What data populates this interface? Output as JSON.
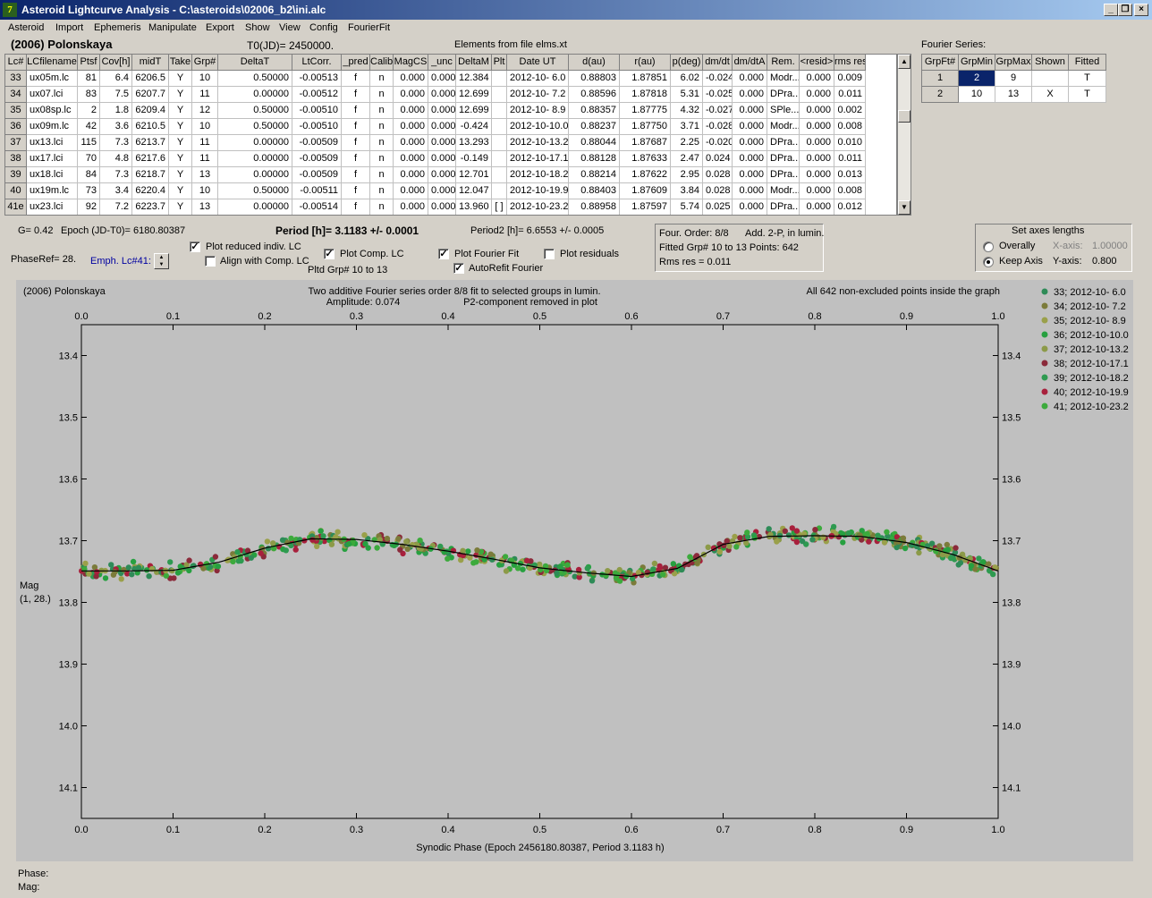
{
  "window": {
    "title": "Asteroid Lightcurve Analysis - C:\\asteroids\\02006_b2\\ini.alc",
    "minimize_label": "_",
    "restore_label": "❐",
    "close_label": "×"
  },
  "menu": [
    "Asteroid",
    "Import",
    "Ephemeris",
    "Manipulate",
    "Export",
    "Show",
    "View",
    "Config",
    "FourierFit"
  ],
  "header": {
    "asteroid_name": "(2006) Polonskaya",
    "t0": "T0(JD)= 2450000.",
    "elements": "Elements from file elms.xt"
  },
  "table": {
    "columns": [
      "Lc#",
      "LCfilename",
      "Ptsf",
      "Cov[h]",
      "midT",
      "Take",
      "Grp#",
      "DeltaT",
      "LtCorr.",
      "_pred",
      "Calib",
      "MagCS",
      "_unc",
      "DeltaM",
      "Plt",
      "Date UT",
      "d(au)",
      "r(au)",
      "p(deg)",
      "dm/dt",
      "dm/dtA",
      "Rem.",
      "<resid>",
      "rms res"
    ],
    "rows": [
      [
        "33",
        "ux05m.lc",
        "81",
        "6.4",
        "6206.5",
        "Y",
        "10",
        "0.50000",
        "-0.00513",
        "f",
        "n",
        "0.000",
        "0.000",
        "12.384",
        "",
        "2012-10- 6.0",
        "0.88803",
        "1.87851",
        "6.02",
        "-0.024",
        "0.000",
        "Modr...",
        "0.000",
        "0.009"
      ],
      [
        "34",
        "ux07.lci",
        "83",
        "7.5",
        "6207.7",
        "Y",
        "11",
        "0.00000",
        "-0.00512",
        "f",
        "n",
        "0.000",
        "0.000",
        "12.699",
        "",
        "2012-10- 7.2",
        "0.88596",
        "1.87818",
        "5.31",
        "-0.025",
        "0.000",
        "DPra...",
        "0.000",
        "0.011"
      ],
      [
        "35",
        "ux08sp.lc",
        "2",
        "1.8",
        "6209.4",
        "Y",
        "12",
        "0.50000",
        "-0.00510",
        "f",
        "n",
        "0.000",
        "0.000",
        "12.699",
        "",
        "2012-10- 8.9",
        "0.88357",
        "1.87775",
        "4.32",
        "-0.027",
        "0.000",
        "SPle...",
        "0.000",
        "0.002"
      ],
      [
        "36",
        "ux09m.lc",
        "42",
        "3.6",
        "6210.5",
        "Y",
        "10",
        "0.50000",
        "-0.00510",
        "f",
        "n",
        "0.000",
        "0.000",
        "-0.424",
        "",
        "2012-10-10.0",
        "0.88237",
        "1.87750",
        "3.71",
        "-0.028",
        "0.000",
        "Modr...",
        "0.000",
        "0.008"
      ],
      [
        "37",
        "ux13.lci",
        "115",
        "7.3",
        "6213.7",
        "Y",
        "11",
        "0.00000",
        "-0.00509",
        "f",
        "n",
        "0.000",
        "0.000",
        "13.293",
        "",
        "2012-10-13.2",
        "0.88044",
        "1.87687",
        "2.25",
        "-0.020",
        "0.000",
        "DPra...",
        "0.000",
        "0.010"
      ],
      [
        "38",
        "ux17.lci",
        "70",
        "4.8",
        "6217.6",
        "Y",
        "11",
        "0.00000",
        "-0.00509",
        "f",
        "n",
        "0.000",
        "0.000",
        "-0.149",
        "",
        "2012-10-17.1",
        "0.88128",
        "1.87633",
        "2.47",
        "0.024",
        "0.000",
        "DPra...",
        "0.000",
        "0.011"
      ],
      [
        "39",
        "ux18.lci",
        "84",
        "7.3",
        "6218.7",
        "Y",
        "13",
        "0.00000",
        "-0.00509",
        "f",
        "n",
        "0.000",
        "0.000",
        "12.701",
        "",
        "2012-10-18.2",
        "0.88214",
        "1.87622",
        "2.95",
        "0.028",
        "0.000",
        "DPra...",
        "0.000",
        "0.013"
      ],
      [
        "40",
        "ux19m.lc",
        "73",
        "3.4",
        "6220.4",
        "Y",
        "10",
        "0.50000",
        "-0.00511",
        "f",
        "n",
        "0.000",
        "0.000",
        "12.047",
        "",
        "2012-10-19.9",
        "0.88403",
        "1.87609",
        "3.84",
        "0.028",
        "0.000",
        "Modr...",
        "0.000",
        "0.008"
      ],
      [
        "41e",
        "ux23.lci",
        "92",
        "7.2",
        "6223.7",
        "Y",
        "13",
        "0.00000",
        "-0.00514",
        "f",
        "n",
        "0.000",
        "0.000",
        "13.960",
        "[ ]",
        "2012-10-23.2",
        "0.88958",
        "1.87597",
        "5.74",
        "0.025",
        "0.000",
        "DPra...",
        "0.000",
        "0.012"
      ]
    ]
  },
  "fourier_series": {
    "title": "Fourier Series:",
    "columns": [
      "GrpFt#",
      "GrpMin",
      "GrpMax",
      "Shown",
      "Fitted"
    ],
    "rows": [
      [
        "1",
        "2",
        "9",
        "",
        "T"
      ],
      [
        "2",
        "10",
        "13",
        "X",
        "T"
      ]
    ]
  },
  "controls": {
    "g": "G= 0.42",
    "epoch": "Epoch (JD-T0)= 6180.80387",
    "period": "Period [h]= 3.1183 +/- 0.0001",
    "period2": "Period2 [h]= 6.6553 +/- 0.0005",
    "phaseref": "PhaseRef= 28.",
    "emph": "Emph. Lc#41:",
    "plot_reduced": "Plot reduced indiv. LC",
    "align_comp": "Align with Comp. LC",
    "plot_comp": "Plot Comp. LC",
    "pltd_grp": "Pltd Grp#  10 to   13",
    "plot_fourier": "Plot Fourier Fit",
    "autorefit": "AutoRefit Fourier",
    "plot_residuals": "Plot residuals",
    "check_mark": "✓"
  },
  "fit_info": {
    "order": "Four. Order:  8/8",
    "add": "Add. 2-P, in lumin.",
    "fitted": "Fitted Grp# 10 to 13 Points: 642",
    "rms": "Rms res     = 0.011"
  },
  "axes_box": {
    "title": "Set axes lengths",
    "overally": "Overally",
    "keep": "Keep Axis",
    "xaxis_label": "X-axis:",
    "xaxis_value": "1.00000",
    "yaxis_label": "Y-axis:",
    "yaxis_value": "0.800"
  },
  "chart_data": {
    "type": "scatter",
    "title": "Two additive Fourier series order 8/8 fit to selected groups in lumin.",
    "subtitle_left": "(2006) Polonskaya",
    "amplitude": "Amplitude: 0.074",
    "p2_note": "P2-component removed in plot",
    "points_note": "All 642 non-excluded points inside the graph",
    "xlabel": "Synodic Phase (Epoch 2456180.80387, Period 3.1183 h)",
    "ylabel_line1": "Mag",
    "ylabel_line2": "(1, 28.)",
    "xlim": [
      0.0,
      1.0
    ],
    "ylim": [
      13.35,
      14.15
    ],
    "y_inverted": true,
    "x_ticks": [
      "0.0",
      "0.1",
      "0.2",
      "0.3",
      "0.4",
      "0.5",
      "0.6",
      "0.7",
      "0.8",
      "0.9",
      "1.0"
    ],
    "y_ticks": [
      "13.4",
      "13.5",
      "13.6",
      "13.7",
      "13.8",
      "13.9",
      "14.0",
      "14.1"
    ],
    "fit_curve": [
      [
        0.0,
        13.749
      ],
      [
        0.05,
        13.749
      ],
      [
        0.1,
        13.748
      ],
      [
        0.15,
        13.735
      ],
      [
        0.2,
        13.712
      ],
      [
        0.25,
        13.697
      ],
      [
        0.3,
        13.698
      ],
      [
        0.35,
        13.706
      ],
      [
        0.4,
        13.717
      ],
      [
        0.45,
        13.73
      ],
      [
        0.5,
        13.744
      ],
      [
        0.55,
        13.752
      ],
      [
        0.6,
        13.758
      ],
      [
        0.65,
        13.745
      ],
      [
        0.7,
        13.706
      ],
      [
        0.75,
        13.693
      ],
      [
        0.8,
        13.692
      ],
      [
        0.85,
        13.693
      ],
      [
        0.9,
        13.703
      ],
      [
        0.95,
        13.722
      ],
      [
        1.0,
        13.749
      ]
    ],
    "legend": [
      {
        "label": "33; 2012-10- 6.0",
        "color": "#2e8b57"
      },
      {
        "label": "34; 2012-10- 7.2",
        "color": "#7b7b3a"
      },
      {
        "label": "35; 2012-10- 8.9",
        "color": "#9aa04a"
      },
      {
        "label": "36; 2012-10-10.0",
        "color": "#27a040"
      },
      {
        "label": "37; 2012-10-13.2",
        "color": "#8c9a48"
      },
      {
        "label": "38; 2012-10-17.1",
        "color": "#8b2a3a"
      },
      {
        "label": "39; 2012-10-18.2",
        "color": "#2e9a50"
      },
      {
        "label": "40; 2012-10-19.9",
        "color": "#a8203c"
      },
      {
        "label": "41; 2012-10-23.2",
        "color": "#3caa3c"
      }
    ],
    "legend_placement": "right"
  },
  "status": {
    "phase": "Phase:",
    "mag": "Mag:"
  }
}
